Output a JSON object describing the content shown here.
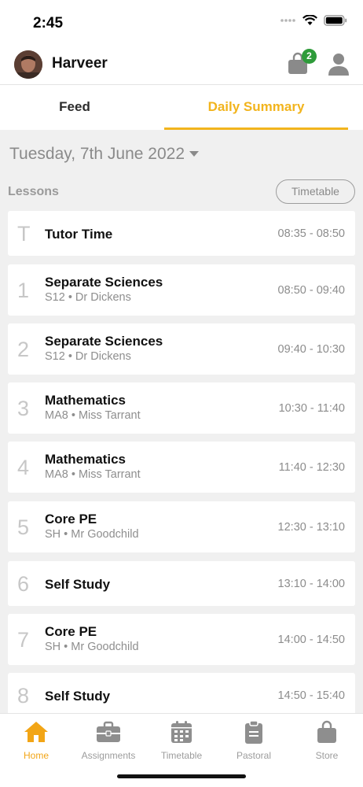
{
  "status_bar": {
    "time": "2:45"
  },
  "header": {
    "user_name": "Harveer",
    "bag_badge_count": "2"
  },
  "tabs": [
    {
      "label": "Feed",
      "active": false
    },
    {
      "label": "Daily Summary",
      "active": true
    }
  ],
  "date": {
    "label": "Tuesday, 7th June 2022"
  },
  "lessons_section": {
    "title": "Lessons",
    "timetable_button": "Timetable"
  },
  "lessons": [
    {
      "period": "T",
      "subject": "Tutor Time",
      "detail": "",
      "time": "08:35 - 08:50"
    },
    {
      "period": "1",
      "subject": "Separate Sciences",
      "detail": "S12 • Dr Dickens",
      "time": "08:50 - 09:40"
    },
    {
      "period": "2",
      "subject": "Separate Sciences",
      "detail": "S12 • Dr Dickens",
      "time": "09:40 - 10:30"
    },
    {
      "period": "3",
      "subject": "Mathematics",
      "detail": "MA8 • Miss Tarrant",
      "time": "10:30 - 11:40"
    },
    {
      "period": "4",
      "subject": "Mathematics",
      "detail": "MA8 • Miss Tarrant",
      "time": "11:40 - 12:30"
    },
    {
      "period": "5",
      "subject": "Core PE",
      "detail": "SH • Mr Goodchild",
      "time": "12:30 - 13:10"
    },
    {
      "period": "6",
      "subject": "Self Study",
      "detail": "",
      "time": "13:10 - 14:00"
    },
    {
      "period": "7",
      "subject": "Core PE",
      "detail": "SH • Mr Goodchild",
      "time": "14:00 - 14:50"
    },
    {
      "period": "8",
      "subject": "Self Study",
      "detail": "",
      "time": "14:50 - 15:40"
    }
  ],
  "tabbar": [
    {
      "label": "Home",
      "icon": "home-icon",
      "active": true
    },
    {
      "label": "Assignments",
      "icon": "briefcase-icon",
      "active": false
    },
    {
      "label": "Timetable",
      "icon": "calendar-icon",
      "active": false
    },
    {
      "label": "Pastoral",
      "icon": "clipboard-icon",
      "active": false
    },
    {
      "label": "Store",
      "icon": "shopping-bag-icon",
      "active": false
    }
  ],
  "colors": {
    "accent": "#f2b41d",
    "badge": "#2e9b3a",
    "background": "#f0f0f0"
  }
}
